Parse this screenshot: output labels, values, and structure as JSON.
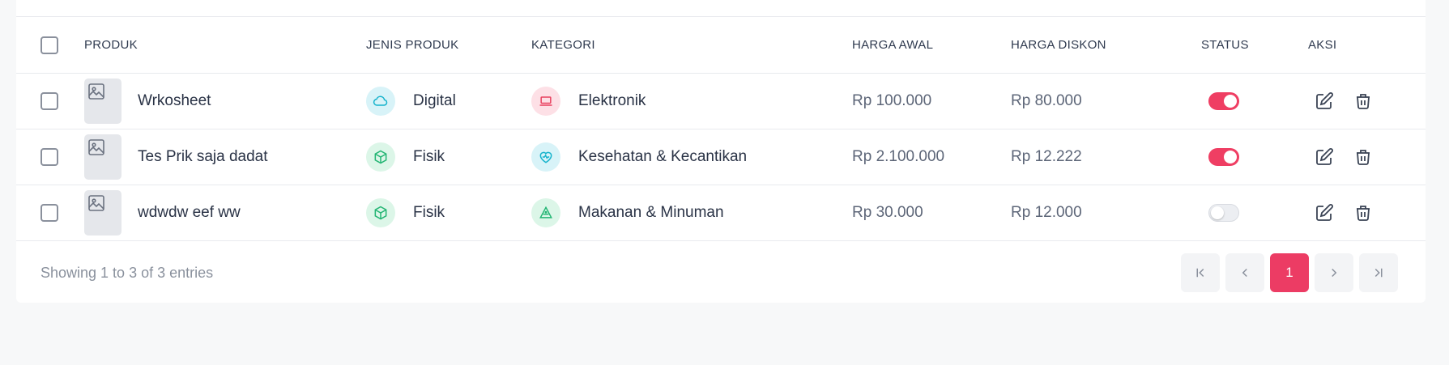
{
  "table": {
    "headers": {
      "produk": "PRODUK",
      "jenis": "JENIS PRODUK",
      "kategori": "KATEGORI",
      "harga_awal": "HARGA AWAL",
      "harga_diskon": "HARGA DISKON",
      "status": "STATUS",
      "aksi": "AKSI"
    },
    "rows": [
      {
        "name": "Wrkosheet",
        "jenis": "Digital",
        "jenis_icon": "cloud-icon",
        "kategori": "Elektronik",
        "kategori_icon": "laptop-icon",
        "harga_awal": "Rp 100.000",
        "harga_diskon": "Rp 80.000",
        "status_on": true
      },
      {
        "name": "Tes Prik saja dadat",
        "jenis": "Fisik",
        "jenis_icon": "box-icon",
        "kategori": "Kesehatan & Kecantikan",
        "kategori_icon": "heart-pulse-icon",
        "harga_awal": "Rp 2.100.000",
        "harga_diskon": "Rp 12.222",
        "status_on": true
      },
      {
        "name": "wdwdw eef ww",
        "jenis": "Fisik",
        "jenis_icon": "box-icon",
        "kategori": "Makanan & Minuman",
        "kategori_icon": "food-icon",
        "harga_awal": "Rp 30.000",
        "harga_diskon": "Rp 12.000",
        "status_on": false
      }
    ]
  },
  "footer": {
    "showing_text": "Showing 1 to 3 of 3 entries",
    "current_page": "1"
  },
  "colors": {
    "accent": "#ec3c64",
    "toggle_on": "#ef3e63",
    "cyan_icon": "#16b3cc",
    "green_icon": "#22b573",
    "pink_icon": "#e8415f"
  }
}
